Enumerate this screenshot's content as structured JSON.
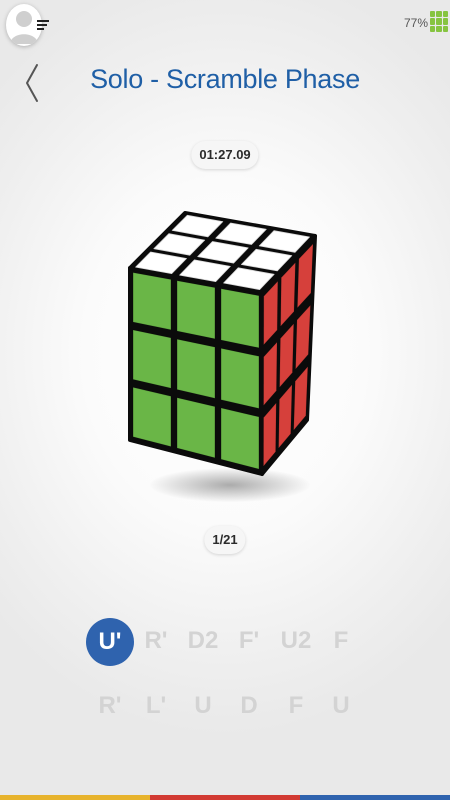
{
  "status": {
    "battery": "77%"
  },
  "header": {
    "title": "Solo - Scramble Phase"
  },
  "timer": "01:27.09",
  "progress": "1/21",
  "moves": {
    "row1": [
      "U'",
      "R'",
      "D2",
      "F'",
      "U2",
      "F"
    ],
    "row2": [
      "R'",
      "L'",
      "U",
      "D",
      "F",
      "U"
    ],
    "current_index": 0
  },
  "colors": {
    "title": "#1f5fa6",
    "active_move": "#2f63ae",
    "inactive_move": "#d3d3d3",
    "cube_front": "#6ab647",
    "cube_right": "#d6403b",
    "cube_top": "#ffffff",
    "stripe": [
      "#e7b32c",
      "#d23a33",
      "#2f63ae"
    ]
  }
}
